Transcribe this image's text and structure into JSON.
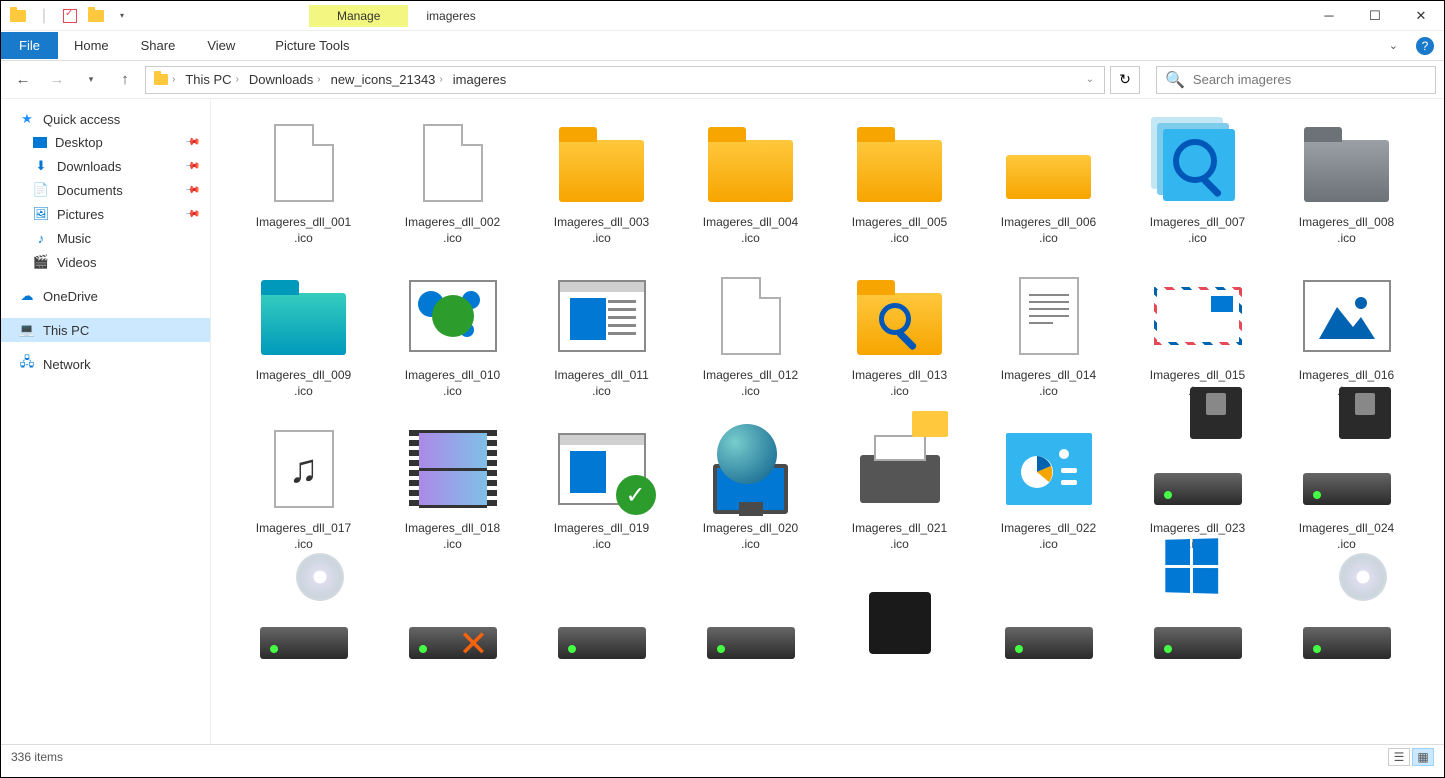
{
  "titlebar": {
    "manage_label": "Manage",
    "window_title": "imageres"
  },
  "ribbon": {
    "file": "File",
    "tabs": [
      "Home",
      "Share",
      "View"
    ],
    "picture_tools": "Picture Tools"
  },
  "breadcrumb": [
    "This PC",
    "Downloads",
    "new_icons_21343",
    "imageres"
  ],
  "search": {
    "placeholder": "Search imageres"
  },
  "sidebar": {
    "quick_access": "Quick access",
    "qa_items": [
      {
        "label": "Desktop",
        "pinned": true
      },
      {
        "label": "Downloads",
        "pinned": true
      },
      {
        "label": "Documents",
        "pinned": true
      },
      {
        "label": "Pictures",
        "pinned": true
      },
      {
        "label": "Music",
        "pinned": false
      },
      {
        "label": "Videos",
        "pinned": false
      }
    ],
    "onedrive": "OneDrive",
    "this_pc": "This PC",
    "network": "Network"
  },
  "files": [
    {
      "name": "Imageres_dll_001.ico",
      "kind": "blank"
    },
    {
      "name": "Imageres_dll_002.ico",
      "kind": "blank"
    },
    {
      "name": "Imageres_dll_003.ico",
      "kind": "folder"
    },
    {
      "name": "Imageres_dll_004.ico",
      "kind": "folder"
    },
    {
      "name": "Imageres_dll_005.ico",
      "kind": "folder"
    },
    {
      "name": "Imageres_dll_006.ico",
      "kind": "folder-flat"
    },
    {
      "name": "Imageres_dll_007.ico",
      "kind": "search-stack"
    },
    {
      "name": "Imageres_dll_008.ico",
      "kind": "folder-gray"
    },
    {
      "name": "Imageres_dll_009.ico",
      "kind": "folder-teal"
    },
    {
      "name": "Imageres_dll_010.ico",
      "kind": "3dwindow"
    },
    {
      "name": "Imageres_dll_011.ico",
      "kind": "window-doc"
    },
    {
      "name": "Imageres_dll_012.ico",
      "kind": "blank"
    },
    {
      "name": "Imageres_dll_013.ico",
      "kind": "folder-search"
    },
    {
      "name": "Imageres_dll_014.ico",
      "kind": "text"
    },
    {
      "name": "Imageres_dll_015.ico",
      "kind": "mail"
    },
    {
      "name": "Imageres_dll_016.ico",
      "kind": "picture"
    },
    {
      "name": "Imageres_dll_017.ico",
      "kind": "music"
    },
    {
      "name": "Imageres_dll_018.ico",
      "kind": "video"
    },
    {
      "name": "Imageres_dll_019.ico",
      "kind": "window-check"
    },
    {
      "name": "Imageres_dll_020.ico",
      "kind": "globe-monitor"
    },
    {
      "name": "Imageres_dll_021.ico",
      "kind": "printer"
    },
    {
      "name": "Imageres_dll_022.ico",
      "kind": "cpanel"
    },
    {
      "name": "Imageres_dll_023.ico",
      "kind": "drive-floppy"
    },
    {
      "name": "Imageres_dll_024.ico",
      "kind": "drive-floppy"
    },
    {
      "name": "",
      "kind": "drive-disc"
    },
    {
      "name": "",
      "kind": "drive-x"
    },
    {
      "name": "",
      "kind": "drive"
    },
    {
      "name": "",
      "kind": "drive"
    },
    {
      "name": "",
      "kind": "chip"
    },
    {
      "name": "",
      "kind": "drive"
    },
    {
      "name": "",
      "kind": "drive-win"
    },
    {
      "name": "",
      "kind": "drive-disc"
    }
  ],
  "status": {
    "item_count": "336 items"
  }
}
